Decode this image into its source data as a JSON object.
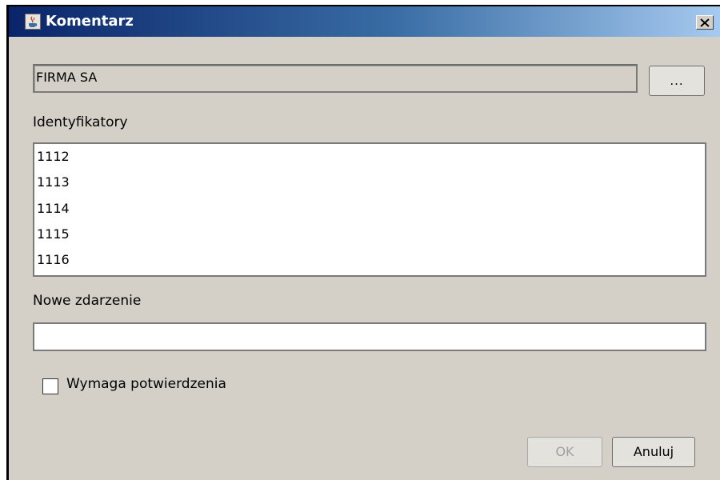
{
  "window": {
    "title": "Komentarz",
    "app_icon": "java-cup-icon",
    "close_icon": "close-icon"
  },
  "company": {
    "value": "FIRMA SA",
    "browse_label": "..."
  },
  "identifiers": {
    "label": "Identyfikatory",
    "items": [
      "1112",
      "1113",
      "1114",
      "1115",
      "1116"
    ]
  },
  "new_event": {
    "label": "Nowe zdarzenie",
    "value": ""
  },
  "requires_confirmation": {
    "label": "Wymaga potwierdzenia",
    "checked": false
  },
  "buttons": {
    "ok_label": "OK",
    "ok_enabled": false,
    "cancel_label": "Anuluj"
  }
}
